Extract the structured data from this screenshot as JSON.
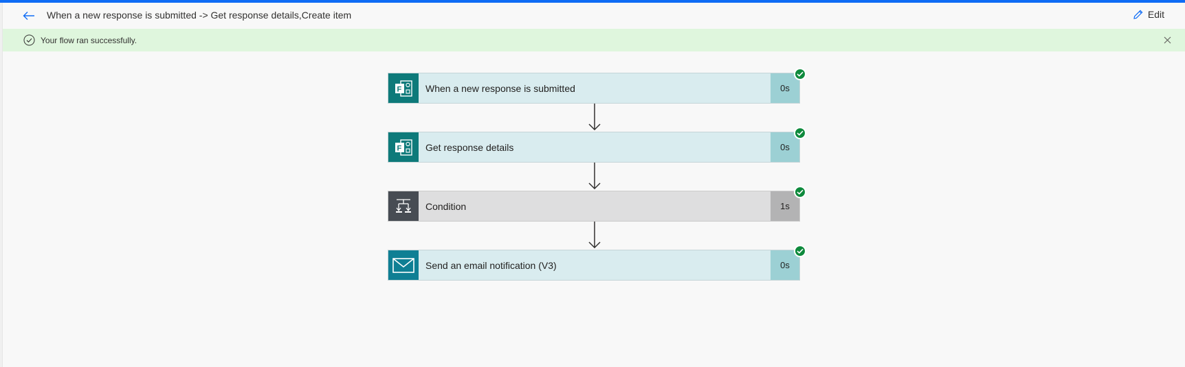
{
  "header": {
    "title": "When a new response is submitted -> Get response details,Create item",
    "edit_label": "Edit"
  },
  "banner": {
    "message": "Your flow ran successfully."
  },
  "colors": {
    "accent": "#0f6cf5",
    "forms_teal": "#0e7a7a",
    "condition_gray": "#474c53",
    "outlook_teal": "#0f7f94",
    "success_green": "#0e8a3c"
  },
  "steps": [
    {
      "label": "When a new response is submitted",
      "duration": "0s",
      "icon": "forms-icon",
      "status": "succeeded"
    },
    {
      "label": "Get response details",
      "duration": "0s",
      "icon": "forms-icon",
      "status": "succeeded"
    },
    {
      "label": "Condition",
      "duration": "1s",
      "icon": "condition-icon",
      "status": "succeeded"
    },
    {
      "label": "Send an email notification (V3)",
      "duration": "0s",
      "icon": "mail-icon",
      "status": "succeeded"
    }
  ]
}
